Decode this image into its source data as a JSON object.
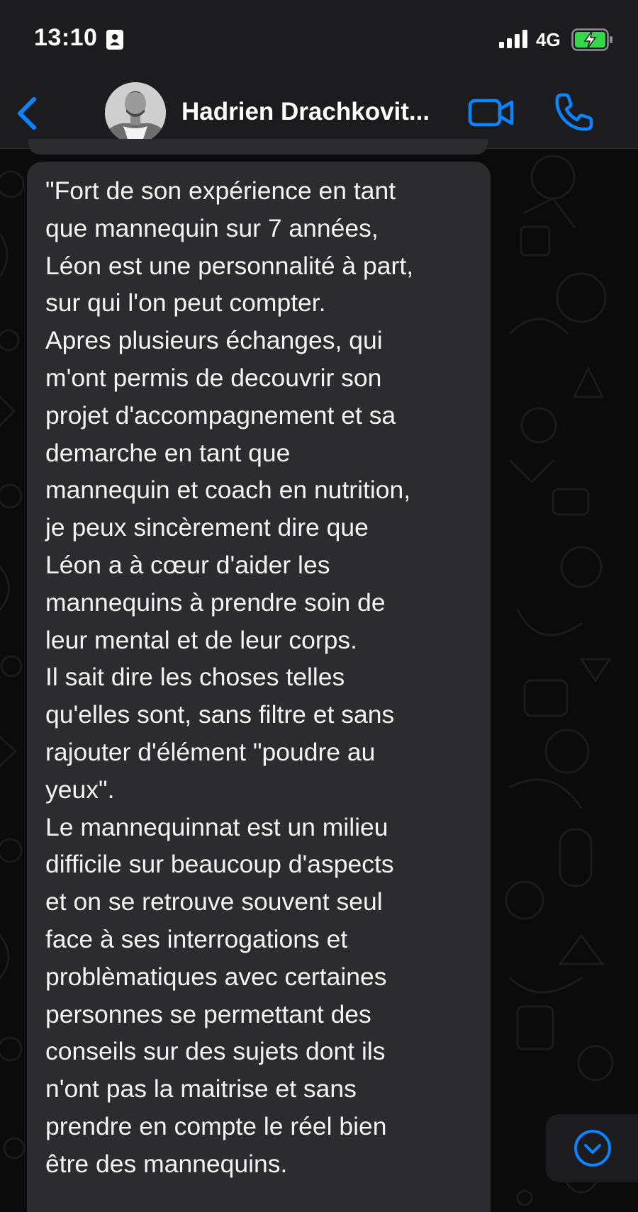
{
  "status_bar": {
    "time": "13:10",
    "network": "4G",
    "icons": [
      "person-badge-icon",
      "signal-bars-icon",
      "battery-charging-icon"
    ]
  },
  "header": {
    "contact_name": "Hadrien Drachkovit...",
    "icons": [
      "back-chevron-icon",
      "video-camera-icon",
      "phone-icon"
    ],
    "accent_color": "#0a84ff"
  },
  "message": {
    "lines": [
      "\"Fort de son expérience en tant",
      "que mannequin sur 7 années,",
      "Léon est une personnalité à part,",
      "sur qui l'on peut compter.",
      "Apres plusieurs échanges, qui",
      "m'ont permis de decouvrir son",
      "projet d'accompagnement et sa",
      "demarche en tant que",
      "mannequin et coach en nutrition,",
      "je peux sincèrement dire que",
      "Léon a à cœur d'aider les",
      "mannequins à prendre soin de",
      "leur mental et de leur corps.",
      "Il sait dire les choses telles",
      "qu'elles sont, sans filtre et sans",
      "rajouter d'élément \"poudre au",
      "yeux\".",
      "Le mannequinnat est un milieu",
      "difficile sur beaucoup d'aspects",
      "et on se retrouve souvent seul",
      "face à ses interrogations et",
      "problèmatiques avec certaines",
      "personnes se permettant des",
      "conseils sur des sujets dont ils",
      "n'ont pas la maitrise et sans",
      "prendre en compte le réel bien",
      "être des mannequins."
    ]
  },
  "colors": {
    "header_bg": "#1c1c1e",
    "bubble_bg": "#2c2c2e",
    "wallpaper_bg": "#0b0b0b",
    "battery_fill": "#32d74b"
  }
}
